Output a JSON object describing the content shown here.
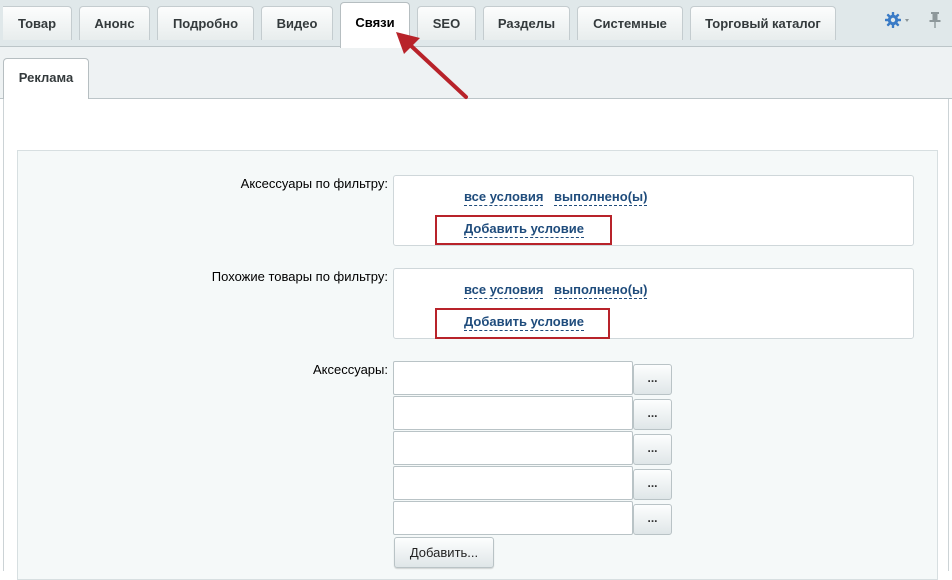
{
  "tabs": [
    {
      "label": "Товар",
      "active": false
    },
    {
      "label": "Анонс",
      "active": false
    },
    {
      "label": "Подробно",
      "active": false
    },
    {
      "label": "Видео",
      "active": false
    },
    {
      "label": "Связи",
      "active": true
    },
    {
      "label": "SEO",
      "active": false
    },
    {
      "label": "Разделы",
      "active": false
    },
    {
      "label": "Системные",
      "active": false
    },
    {
      "label": "Торговый каталог",
      "active": false
    }
  ],
  "toolbar": {
    "settings_icon": "gear-icon",
    "pin_icon": "pin-icon"
  },
  "subtabs": [
    {
      "label": "Реклама",
      "active": true
    }
  ],
  "form": {
    "accessories_filter": {
      "label": "Аксессуары по фильтру:",
      "all_conditions": "все условия",
      "fulfilled": "выполнено(ы)",
      "add_condition": "Добавить условие"
    },
    "similar_filter": {
      "label": "Похожие товары по фильтру:",
      "all_conditions": "все условия",
      "fulfilled": "выполнено(ы)",
      "add_condition": "Добавить условие"
    },
    "accessories": {
      "label": "Аксессуары:",
      "inputs": [
        "",
        "",
        "",
        "",
        ""
      ],
      "browse_label": "...",
      "add_label": "Добавить..."
    }
  },
  "colors": {
    "arrow": "#b8232a",
    "highlight": "#b8232a",
    "link": "#1f4c7c"
  }
}
